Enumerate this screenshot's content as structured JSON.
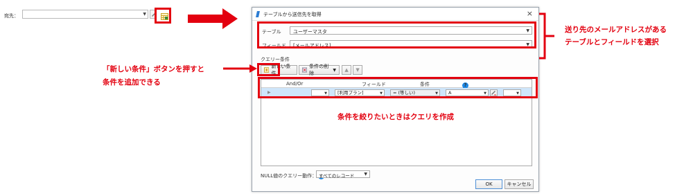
{
  "mini_form": {
    "dest_label": "宛先："
  },
  "dialog": {
    "title": "テーブルから送信先を取得",
    "table_label": "テーブル",
    "table_value": "ユーザーマスタ",
    "field_label": "フィールド",
    "field_value": "[メールアドレス]",
    "query_label": "クエリー条件",
    "toolbar": {
      "new_condition": "新しい条件",
      "delete_condition": "条件の削除"
    },
    "grid": {
      "headers": [
        "And/Or",
        "フィールド",
        "条件",
        "値"
      ],
      "row": {
        "field": "[利用プラン]",
        "condition": "= (等しい)",
        "value": "A"
      }
    },
    "null_label": "NULL値のクエリー動作：",
    "null_value": "すべてのレコード",
    "ok_label": "OK",
    "cancel_label": "キャンセル"
  },
  "annotations": {
    "right_line1": "送り先のメールアドレスがある",
    "right_line2": "テーブルとフィールドを選択",
    "left_line1": "「新しい条件」ボタンを押すと",
    "left_line2": "条件を追加できる",
    "center": "条件を絞りたいときはクエリを作成"
  },
  "colors": {
    "annotation_red": "#e3000f",
    "selection_blue": "#cfe6fb",
    "help_blue": "#1e88e5"
  }
}
